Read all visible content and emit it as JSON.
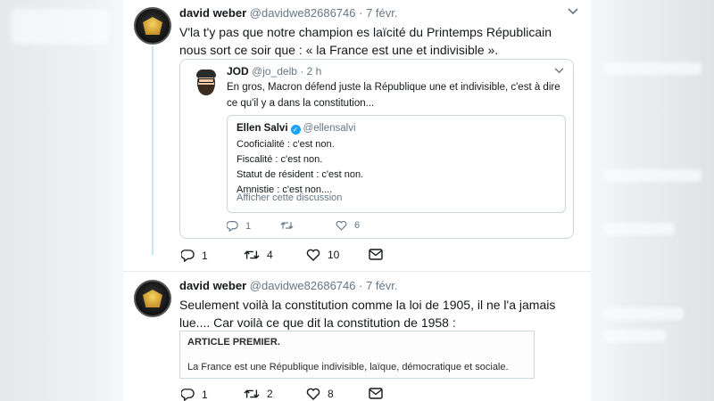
{
  "tweets": [
    {
      "name": "david weber",
      "handle": "@davidwe82686746",
      "dot": "·",
      "date": "7 févr.",
      "text": "V'la t'y pas que notre champion es laïcité du Printemps Républicain nous sort ce soir que : « la France est une et indivisible ».",
      "quoted": {
        "name": "JOD",
        "handle": "@jo_delb",
        "dot": "·",
        "date": "2 h",
        "text": "En gros, Macron défend juste la République une et indivisible, c'est à dire ce qu'il y a dans la constitution...",
        "inner": {
          "name": "Ellen Salvi",
          "handle": "@ellensalvi",
          "lines": [
            "Cooficialité : c'est non.",
            "Fiscalité : c'est non.",
            "Statut de résident : c'est non.",
            "Amnistie : c'est non...."
          ],
          "link": "Afficher cette discussion"
        },
        "actions": {
          "replies": "1",
          "retweets": "",
          "likes": "6"
        }
      },
      "actions": {
        "replies": "1",
        "retweets": "4",
        "likes": "10"
      }
    },
    {
      "name": "david weber",
      "handle": "@davidwe82686746",
      "dot": "·",
      "date": "7 févr.",
      "text": "Seulement voilà la constitution comme la loi de 1905, il ne l'a jamais lue.... Car voilà ce que dit la constitution de 1958 :",
      "image": {
        "title": "ARTICLE PREMIER.",
        "body": "La France est une République indivisible, laïque, démocratique et sociale."
      },
      "actions": {
        "replies": "1",
        "retweets": "2",
        "likes": "8"
      }
    }
  ],
  "colors": {
    "accent": "#1da1f2",
    "muted": "#657786",
    "text": "#14171a",
    "thread": "#c4e6f8"
  },
  "icons": [
    "reply-icon",
    "retweet-icon",
    "like-icon",
    "message-icon",
    "chevron-down-icon",
    "verified-icon"
  ]
}
